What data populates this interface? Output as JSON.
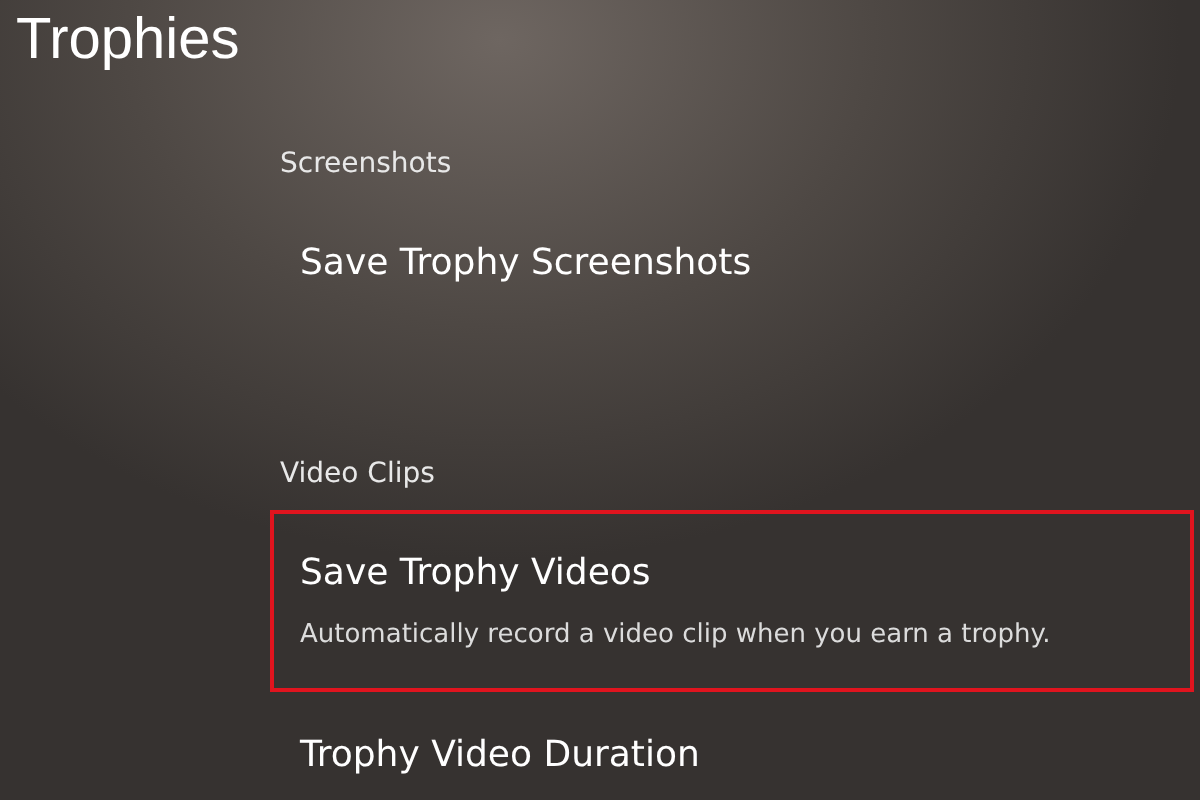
{
  "title": "Trophies",
  "sections": [
    {
      "heading": "Screenshots",
      "items": [
        {
          "label": "Save Trophy Screenshots",
          "highlighted": false
        }
      ]
    },
    {
      "heading": "Video Clips",
      "items": [
        {
          "label": "Save Trophy Videos",
          "description": "Automatically record a video clip when you earn a trophy.",
          "highlighted": true
        },
        {
          "label": "Trophy Video Duration",
          "highlighted": false
        }
      ]
    }
  ]
}
